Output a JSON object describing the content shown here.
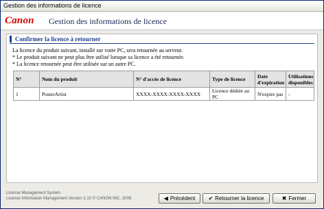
{
  "window": {
    "title": "Gestion des informations de licence"
  },
  "header": {
    "logo_text": "Canon",
    "title": "Gestion des informations de licence"
  },
  "section": {
    "title": "Confirmer la licence à retourner"
  },
  "messages": [
    "La licence du produit suivant, installé sur votre PC, sera retournée au serveur.",
    "* Le produit suivant ne peut plus être utilisé lorsque sa licence a été retournée.",
    "* La licence retournée peut être utilisée sur un autre PC."
  ],
  "table": {
    "headers": {
      "no": "N°",
      "product": "Nom du produit",
      "access": "N° d'accès de licence",
      "type": "Type de licence",
      "expiry": "Date d'expiration",
      "available": "Utilisations disponibles"
    },
    "rows": [
      {
        "no": "1",
        "product": "PosterArtist",
        "access": "XXXX-XXXX-XXXX-XXXX",
        "type": "Licence dédiée au PC",
        "expiry": "N'expire pas",
        "available": "-"
      }
    ]
  },
  "footer": {
    "line1": "License Management System",
    "line2": "License Information Management Version 2.10 © CANON INC. 2008"
  },
  "buttons": {
    "prev_label": "Précédent",
    "return_label": "Retourner la licence",
    "close_label": "Fermer"
  },
  "icons": {
    "prev": "arrow-left-icon",
    "return": "checkmark-icon",
    "close": "close-x-icon"
  },
  "colors": {
    "brand_red": "#cc0000",
    "accent_blue": "#1c3f8c"
  }
}
